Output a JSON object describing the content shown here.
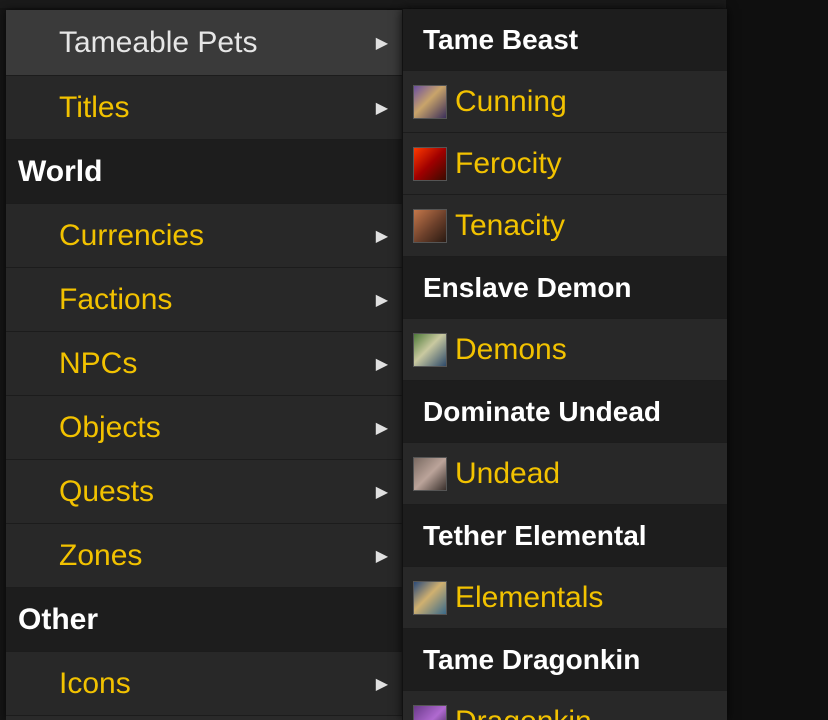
{
  "left_menu": {
    "items": [
      {
        "type": "item",
        "label": "Tameable Pets",
        "hover": true,
        "has_submenu": true
      },
      {
        "type": "item",
        "label": "Titles",
        "has_submenu": true
      },
      {
        "type": "header",
        "label": "World"
      },
      {
        "type": "item",
        "label": "Currencies",
        "has_submenu": true
      },
      {
        "type": "item",
        "label": "Factions",
        "has_submenu": true
      },
      {
        "type": "item",
        "label": "NPCs",
        "has_submenu": true
      },
      {
        "type": "item",
        "label": "Objects",
        "has_submenu": true
      },
      {
        "type": "item",
        "label": "Quests",
        "has_submenu": true
      },
      {
        "type": "item",
        "label": "Zones",
        "has_submenu": true
      },
      {
        "type": "header",
        "label": "Other"
      },
      {
        "type": "item",
        "label": "Icons",
        "has_submenu": true
      }
    ],
    "arrow_glyph": "▶"
  },
  "right_menu": {
    "items": [
      {
        "type": "header",
        "label": "Tame Beast"
      },
      {
        "type": "item",
        "label": "Cunning",
        "icon": "cunning-icon"
      },
      {
        "type": "item",
        "label": "Ferocity",
        "icon": "ferocity-icon"
      },
      {
        "type": "item",
        "label": "Tenacity",
        "icon": "tenacity-icon"
      },
      {
        "type": "header",
        "label": "Enslave Demon"
      },
      {
        "type": "item",
        "label": "Demons",
        "icon": "demons-icon"
      },
      {
        "type": "header",
        "label": "Dominate Undead"
      },
      {
        "type": "item",
        "label": "Undead",
        "icon": "undead-icon"
      },
      {
        "type": "header",
        "label": "Tether Elemental"
      },
      {
        "type": "item",
        "label": "Elementals",
        "icon": "elementals-icon"
      },
      {
        "type": "header",
        "label": "Tame Dragonkin"
      },
      {
        "type": "item",
        "label": "Dragonkin",
        "icon": "dragonkin-icon"
      }
    ]
  },
  "colors": {
    "link": "#f2c200",
    "header_text": "#ffffff",
    "item_bg": "#282828",
    "header_bg": "#1d1d1d",
    "hover_bg": "#3a3a3a"
  }
}
